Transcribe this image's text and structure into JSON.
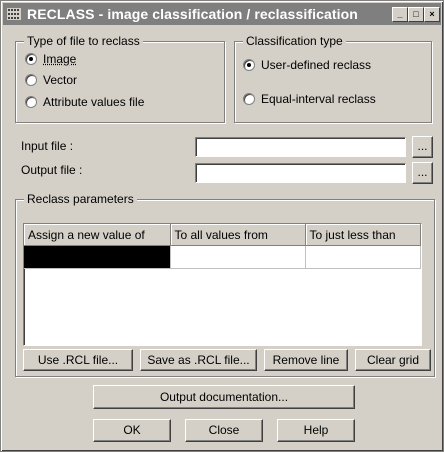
{
  "window": {
    "title": "RECLASS - image classification / reclassification",
    "minimize": "_",
    "restore": "□",
    "close": "×"
  },
  "file_type": {
    "legend": "Type of file to reclass",
    "options": [
      {
        "label": "Image",
        "selected": true
      },
      {
        "label": "Vector",
        "selected": false
      },
      {
        "label": "Attribute values file",
        "selected": false
      }
    ]
  },
  "classification": {
    "legend": "Classification type",
    "options": [
      {
        "label": "User-defined reclass",
        "selected": true
      },
      {
        "label": "Equal-interval reclass",
        "selected": false
      }
    ]
  },
  "input_file": {
    "label": "Input file :",
    "value": "",
    "browse": "..."
  },
  "output_file": {
    "label": "Output file :",
    "value": "",
    "browse": "..."
  },
  "reclass_params": {
    "legend": "Reclass parameters",
    "columns": [
      "Assign a new value of",
      "To all values from",
      "To just less than"
    ],
    "rows": [
      [
        "",
        "",
        ""
      ]
    ]
  },
  "grid_buttons": {
    "use_rcl": "Use .RCL file...",
    "save_rcl": "Save as .RCL file...",
    "remove_line": "Remove line",
    "clear_grid": "Clear grid"
  },
  "output_documentation": "Output documentation...",
  "footer": {
    "ok": "OK",
    "close": "Close",
    "help": "Help"
  },
  "colors": {
    "titlebar": "#7f7f7f",
    "face": "#d4d0c8"
  }
}
